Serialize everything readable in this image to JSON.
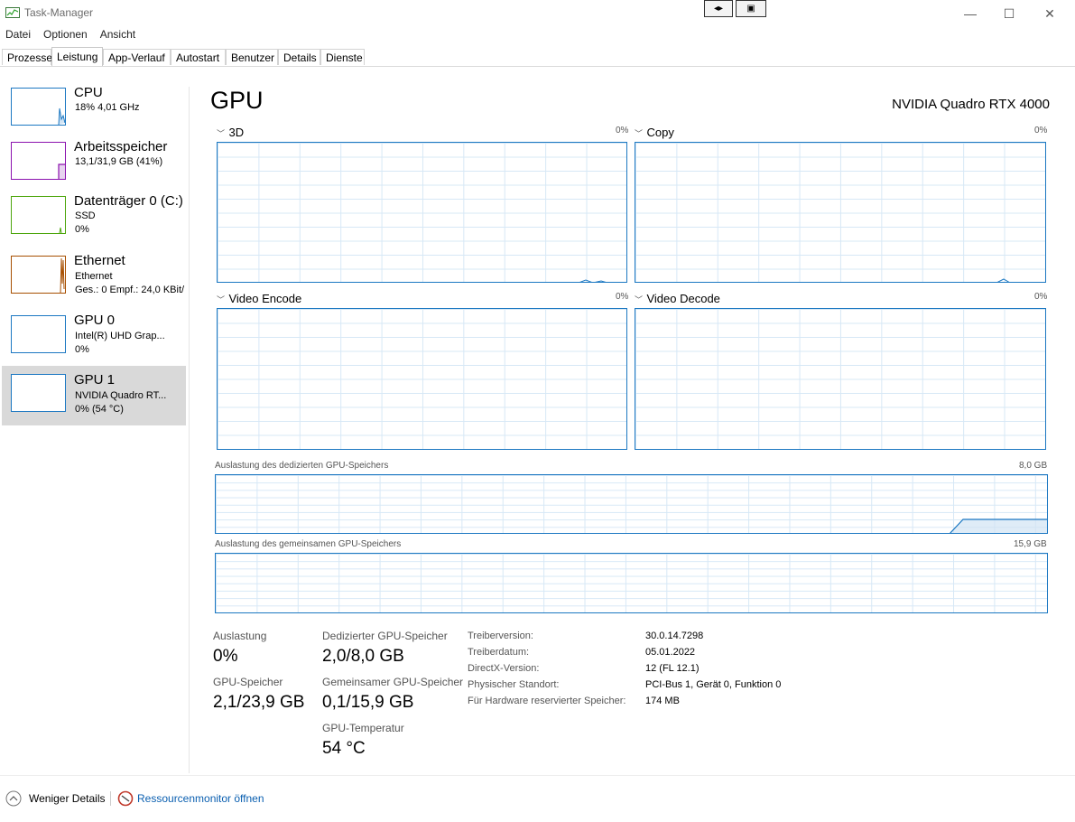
{
  "window": {
    "title": "Task-Manager"
  },
  "menu": [
    "Datei",
    "Optionen",
    "Ansicht"
  ],
  "tabs": [
    "Prozesse",
    "Leistung",
    "App-Verlauf",
    "Autostart",
    "Benutzer",
    "Details",
    "Dienste"
  ],
  "active_tab": "Leistung",
  "sidebar": [
    {
      "title": "CPU",
      "line1": "18%  4,01 GHz",
      "line2": "",
      "color": "#1c78c2"
    },
    {
      "title": "Arbeitsspeicher",
      "line1": "13,1/31,9 GB (41%)",
      "line2": "",
      "color": "#8b12ae"
    },
    {
      "title": "Datenträger 0 (C:)",
      "line1": "SSD",
      "line2": "0%",
      "color": "#4da60c"
    },
    {
      "title": "Ethernet",
      "line1": "Ethernet",
      "line2": "Ges.: 0  Empf.: 24,0 KBit/",
      "color": "#a74f01"
    },
    {
      "title": "GPU 0",
      "line1": "Intel(R) UHD Grap...",
      "line2": "0%",
      "color": "#1c78c2"
    },
    {
      "title": "GPU 1",
      "line1": "NVIDIA Quadro RT...",
      "line2": "0%  (54 °C)",
      "color": "#1c78c2",
      "selected": true
    }
  ],
  "gpu": {
    "title": "GPU",
    "model": "NVIDIA Quadro RTX 4000",
    "engines": [
      {
        "label": "3D",
        "value": "0%"
      },
      {
        "label": "Copy",
        "value": "0%"
      },
      {
        "label": "Video Encode",
        "value": "0%"
      },
      {
        "label": "Video Decode",
        "value": "0%"
      }
    ],
    "dedicated_mem": {
      "label": "Auslastung des dedizierten GPU-Speichers",
      "max": "8,0 GB"
    },
    "shared_mem": {
      "label": "Auslastung des gemeinsamen GPU-Speichers",
      "max": "15,9 GB"
    },
    "stats": {
      "auslastung_label": "Auslastung",
      "auslastung_value": "0%",
      "gpu_speicher_label": "GPU-Speicher",
      "gpu_speicher_value": "2,1/23,9 GB",
      "dedicated_label": "Dedizierter GPU-Speicher",
      "dedicated_value": "2,0/8,0 GB",
      "shared_label": "Gemeinsamer GPU-Speicher",
      "shared_value": "0,1/15,9 GB",
      "temp_label": "GPU-Temperatur",
      "temp_value": "54 °C"
    },
    "info": [
      {
        "label": "Treiberversion:",
        "value": "30.0.14.7298"
      },
      {
        "label": "Treiberdatum:",
        "value": "05.01.2022"
      },
      {
        "label": "DirectX-Version:",
        "value": "12 (FL 12.1)"
      },
      {
        "label": "Physischer Standort:",
        "value": "PCI-Bus 1, Gerät 0, Funktion 0"
      },
      {
        "label": "Für Hardware reservierter Speicher:",
        "value": "174 MB"
      }
    ]
  },
  "footer": {
    "less_details": "Weniger Details",
    "resource_monitor": "Ressourcenmonitor öffnen"
  },
  "colors": {
    "graph_line": "#1c78c2",
    "grid": "#d7e8f6",
    "link": "#0a5fb0"
  }
}
